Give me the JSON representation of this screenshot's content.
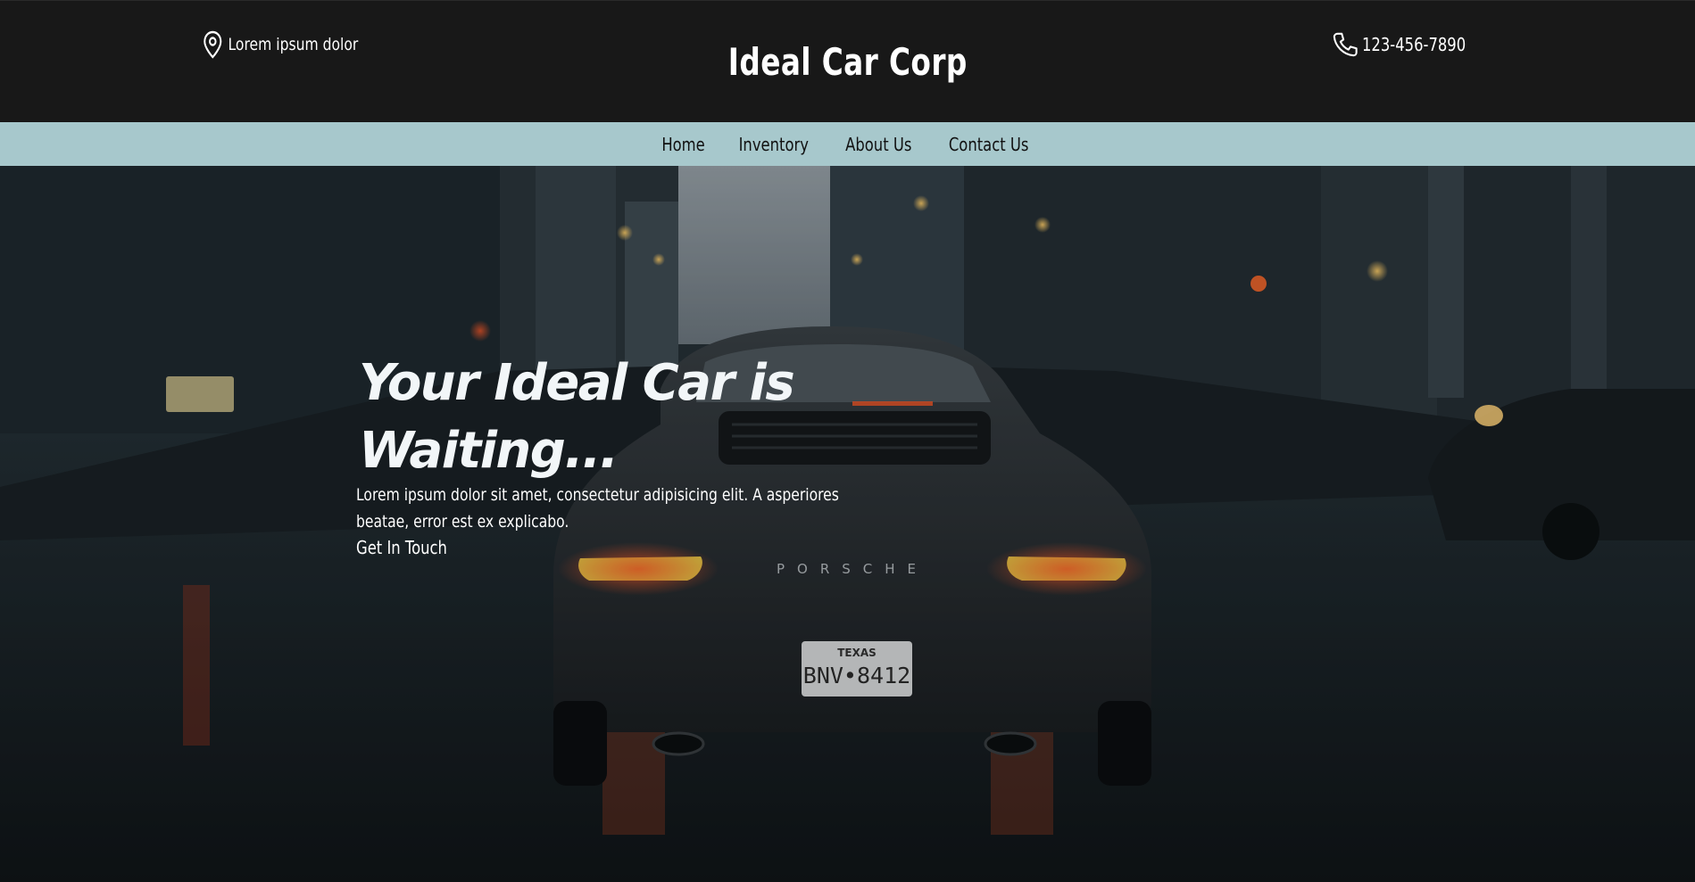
{
  "header": {
    "location_text": "Lorem ipsum dolor",
    "brand": "Ideal Car Corp",
    "phone": "123-456-7890"
  },
  "nav": {
    "items": [
      {
        "label": "Home"
      },
      {
        "label": "Inventory"
      },
      {
        "label": "About Us"
      },
      {
        "label": "Contact Us"
      }
    ]
  },
  "hero": {
    "headline": "Your Ideal Car is Waiting...",
    "subtext": "Lorem ipsum dolor sit amet, consectetur adipisicing elit. A asperiores beatae, error est ex explicabo.",
    "cta_label": "Get In Touch",
    "image": {
      "plate_state": "TEXAS",
      "plate_number": "BNV•8412",
      "car_badge": "PORSCHE"
    }
  },
  "colors": {
    "header_bg": "#181818",
    "nav_bg": "#a7c8cc",
    "text_light": "#ffffff"
  },
  "icons": {
    "location": "map-pin-icon",
    "phone": "phone-icon"
  }
}
